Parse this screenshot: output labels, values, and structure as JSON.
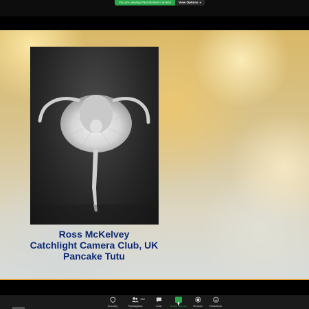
{
  "banner": {
    "viewing_text": "You are viewing Paul Stocker's screen",
    "view_options_label": "View Options"
  },
  "slide": {
    "photo_alt": "Black and white photo of a ballerina in a tutu bending forward",
    "caption_lines": [
      "Ross McKelvey",
      "Catchlight Camera Club, UK",
      "Pancake Tutu"
    ],
    "caption_color": "#0f2a73"
  },
  "toolbar": {
    "items": [
      {
        "label": "Security",
        "icon": "shield-icon"
      },
      {
        "label": "Participants",
        "icon": "participants-icon",
        "count": "158"
      },
      {
        "label": "Chat",
        "icon": "chat-icon"
      },
      {
        "label": "Share Screen",
        "icon": "share-screen-icon"
      },
      {
        "label": "Record",
        "icon": "record-icon"
      },
      {
        "label": "Reactions",
        "icon": "reactions-icon"
      }
    ],
    "share_color": "#2aa84a"
  }
}
